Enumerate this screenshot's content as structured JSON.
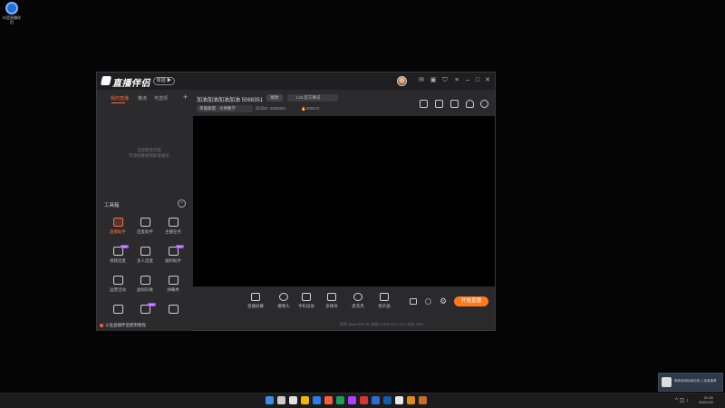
{
  "desktop": {
    "icon_label": "抖音直播伴侣",
    "icon_color": "#1e6fd9"
  },
  "app": {
    "name": "直播伴侣",
    "version_badge": "体验 ▶",
    "titlebar_icons": [
      "avatar",
      "mail-icon",
      "screen-icon",
      "shirt-icon",
      "menu-icon",
      "minimize-icon",
      "maximize-icon",
      "close-icon"
    ]
  },
  "sidebar": {
    "tabs": [
      "我的直播",
      "推流",
      "可选项"
    ],
    "add_label": "+",
    "empty_text": [
      "当前暂无内容",
      "可添加素材到此处展示"
    ],
    "toolbox_title": "工具箱",
    "tools": [
      {
        "label": "直播助手",
        "icon": "assistant-icon",
        "active": true,
        "badge": ""
      },
      {
        "label": "连麦助手",
        "icon": "person-icon",
        "active": false,
        "badge": ""
      },
      {
        "label": "主播任务",
        "icon": "task-icon",
        "active": false,
        "badge": ""
      },
      {
        "label": "视频连麦",
        "icon": "video-call-icon",
        "active": false,
        "badge": "NEW"
      },
      {
        "label": "多人连麦",
        "icon": "multi-call-icon",
        "active": false,
        "badge": ""
      },
      {
        "label": "福利助手",
        "icon": "gift-icon",
        "active": false,
        "badge": "NEW"
      },
      {
        "label": "运营活动",
        "icon": "activity-icon",
        "active": false,
        "badge": ""
      },
      {
        "label": "虚拟形象",
        "icon": "avatar-icon",
        "active": false,
        "badge": ""
      },
      {
        "label": "弹幕秀",
        "icon": "danmaku-icon",
        "active": false,
        "badge": ""
      },
      {
        "label": "",
        "icon": "more-icon-1",
        "active": false,
        "badge": ""
      },
      {
        "label": "",
        "icon": "more-icon-2",
        "active": false,
        "badge": "NEW"
      },
      {
        "label": "",
        "icon": "more-icon-3",
        "active": false,
        "badge": ""
      }
    ],
    "bottom_tip": "斗鱼直播伴侣使用教程"
  },
  "room": {
    "title": "加油加油加油加油 5068351",
    "edit_label": "修改",
    "announcement": "LOL官方赛说",
    "category": "英雄联盟 · 大神教学",
    "room_id": "房间ID: 5068351",
    "hot_count": "306674"
  },
  "controls": [
    {
      "label": "直播屏幕",
      "icon": "screen-share-icon"
    },
    {
      "label": "摄像头",
      "icon": "camera-icon"
    },
    {
      "label": "手机投屏",
      "icon": "phone-cast-icon"
    },
    {
      "label": "多媒体",
      "icon": "media-icon"
    },
    {
      "label": "麦克风",
      "icon": "mic-icon"
    },
    {
      "label": "扬声器",
      "icon": "speaker-icon"
    }
  ],
  "start_label": "开始直播",
  "status_bar": "码率 0kb/s   FPS 30   丢帧 0.00%   CPU 21%   内存 29%",
  "taskbar": {
    "time": "21:18",
    "date": "2022/1/9",
    "apps": [
      "#3a8ee6",
      "#cccccc",
      "#e0e0e0",
      "#f2b500",
      "#2d7df0",
      "#ff5a3c",
      "#1b9e5a",
      "#b03cff",
      "#d33",
      "#2f6bd6",
      "#0e5ea8",
      "#e8e8e8",
      "#e08a1e",
      "#c96b2c"
    ]
  },
  "notification": {
    "text": "推荐游戏持续在线 上传者推荐"
  }
}
